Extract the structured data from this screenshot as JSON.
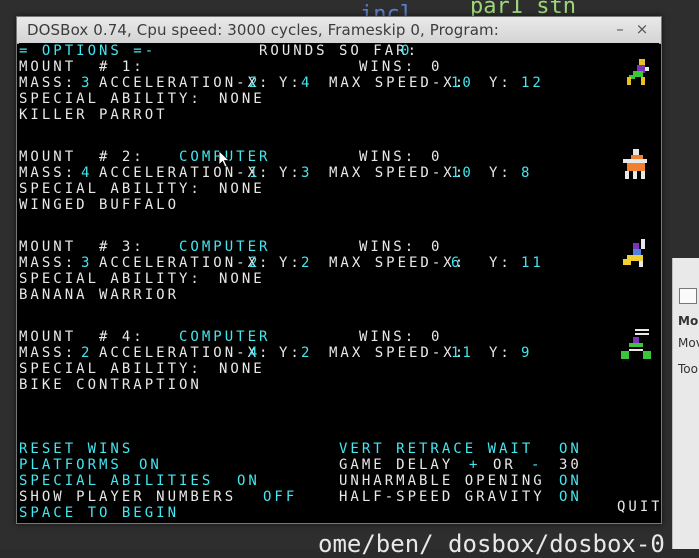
{
  "background": {
    "editor_top_blue": "incl",
    "editor_top_green": "par1 stn",
    "editor_bottom": "ome/ben/ dosbox/dosbox-0",
    "panel_lines": [
      "Mo",
      "Mov",
      "Too"
    ]
  },
  "window": {
    "title": "DOSBox 0.74, Cpu speed:    3000 cycles, Frameskip  0, Program:",
    "min_label": "–",
    "close_label": "×"
  },
  "options": {
    "header_label": "= OPTIONS =-",
    "rounds_label": "ROUNDS SO FAR:",
    "rounds_value": "0"
  },
  "mounts": [
    {
      "label": "MOUNT  # 1:",
      "controller": "",
      "wins_label": "WINS:",
      "wins": "0",
      "mass_label": "MASS:",
      "mass": "3",
      "accel_label": "ACCELERATION-X:",
      "accel_x": "2",
      "y_label": "Y:",
      "accel_y": "4",
      "maxspeed_label": "MAX SPEED-X:",
      "max_x": "10",
      "max_y_label": "Y:",
      "max_y": "12",
      "ability_label": "SPECIAL ABILITY:",
      "ability": "NONE",
      "name": "KILLER PARROT",
      "icon": "parrot-rider-icon"
    },
    {
      "label": "MOUNT  # 2:",
      "controller": "COMPUTER",
      "wins_label": "WINS:",
      "wins": "0",
      "mass_label": "MASS:",
      "mass": "4",
      "accel_label": "ACCELERATION-X:",
      "accel_x": "1",
      "y_label": "Y:",
      "accel_y": "3",
      "maxspeed_label": "MAX SPEED-X:",
      "max_x": "10",
      "max_y_label": "Y:",
      "max_y": "8",
      "ability_label": "SPECIAL ABILITY:",
      "ability": "NONE",
      "name": "WINGED BUFFALO",
      "icon": "buffalo-rider-icon"
    },
    {
      "label": "MOUNT  # 3:",
      "controller": "COMPUTER",
      "wins_label": "WINS:",
      "wins": "0",
      "mass_label": "MASS:",
      "mass": "3",
      "accel_label": "ACCELERATION-X:",
      "accel_x": "2",
      "y_label": "Y:",
      "accel_y": "2",
      "maxspeed_label": "MAX SPEED-X:",
      "max_x": "6",
      "max_y_label": "Y:",
      "max_y": "11",
      "ability_label": "SPECIAL ABILITY:",
      "ability": "NONE",
      "name": "BANANA WARRIOR",
      "icon": "banana-rider-icon"
    },
    {
      "label": "MOUNT  # 4:",
      "controller": "COMPUTER",
      "wins_label": "WINS:",
      "wins": "0",
      "mass_label": "MASS:",
      "mass": "2",
      "accel_label": "ACCELERATION-X:",
      "accel_x": "4",
      "y_label": "Y:",
      "accel_y": "2",
      "maxspeed_label": "MAX SPEED-X:",
      "max_x": "11",
      "max_y_label": "Y:",
      "max_y": "9",
      "ability_label": "SPECIAL ABILITY:",
      "ability": "NONE",
      "name": "BIKE CONTRAPTION",
      "icon": "bike-rider-icon"
    }
  ],
  "settings_left": {
    "reset_wins": "RESET WINS",
    "platforms_label": "PLATFORMS",
    "platforms_value": "ON",
    "special_label": "SPECIAL ABILITIES",
    "special_value": "ON",
    "show_numbers_label": "SHOW PLAYER NUMBERS",
    "show_numbers_value": "OFF",
    "space_to_begin": "SPACE TO BEGIN"
  },
  "settings_right": {
    "vert_label": "VERT RETRACE WAIT",
    "vert_value": "ON",
    "delay_label": "GAME DELAY",
    "delay_plus": "+",
    "delay_or": "OR",
    "delay_minus": "-",
    "delay_value": "30",
    "unharm_label": "UNHARMABLE OPENING",
    "unharm_value": "ON",
    "halfspeed_label": "HALF-SPEED GRAVITY",
    "halfspeed_value": "ON",
    "quit": "QUIT"
  }
}
